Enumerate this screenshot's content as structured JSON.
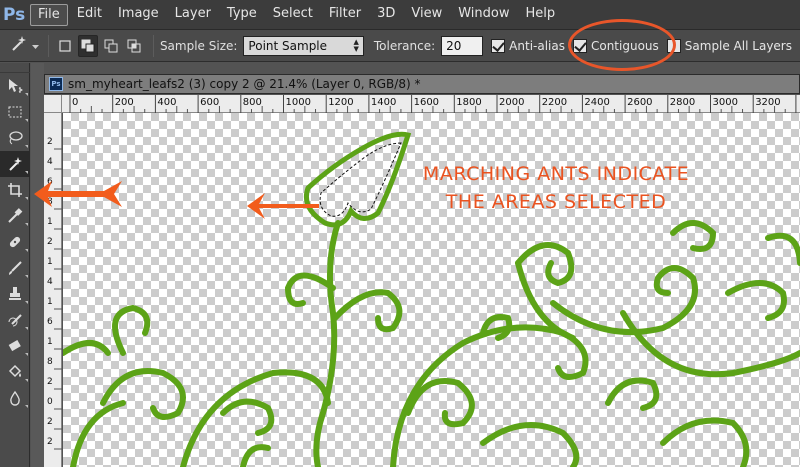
{
  "app": {
    "logo": "Ps"
  },
  "menu": [
    "File",
    "Edit",
    "Image",
    "Layer",
    "Type",
    "Select",
    "Filter",
    "3D",
    "View",
    "Window",
    "Help"
  ],
  "options_bar": {
    "tool_icon": "magic-wand-icon",
    "sample_size_label": "Sample Size:",
    "sample_size_value": "Point Sample",
    "tolerance_label": "Tolerance:",
    "tolerance_value": "20",
    "anti_alias_label": "Anti-alias",
    "anti_alias_checked": true,
    "contiguous_label": "Contiguous",
    "contiguous_checked": true,
    "sample_all_layers_label": "Sample All Layers",
    "sample_all_layers_checked": false
  },
  "document": {
    "icon": "Ps",
    "title": "sm_myheart_leafs2 (3) copy 2 @ 21.4% (Layer 0, RGB/8) *"
  },
  "ruler": {
    "horizontal": [
      "0",
      "200",
      "400",
      "600",
      "800",
      "1000",
      "1200",
      "1400",
      "1600",
      "1800",
      "2000",
      "2200",
      "2400",
      "2600",
      "2800",
      "3000",
      "3200"
    ],
    "vertical": [
      "2",
      "4",
      "6",
      "8",
      "1",
      "2",
      "1",
      "4",
      "1",
      "6",
      "1",
      "8",
      "2",
      "0",
      "2",
      "2",
      "2",
      "4"
    ]
  },
  "annotation": {
    "line1": "MARCHING ANTS INDICATE",
    "line2": "THE AREAS SELECTED"
  },
  "colors": {
    "accent": "#ea5320",
    "vine": "#5ca317"
  }
}
